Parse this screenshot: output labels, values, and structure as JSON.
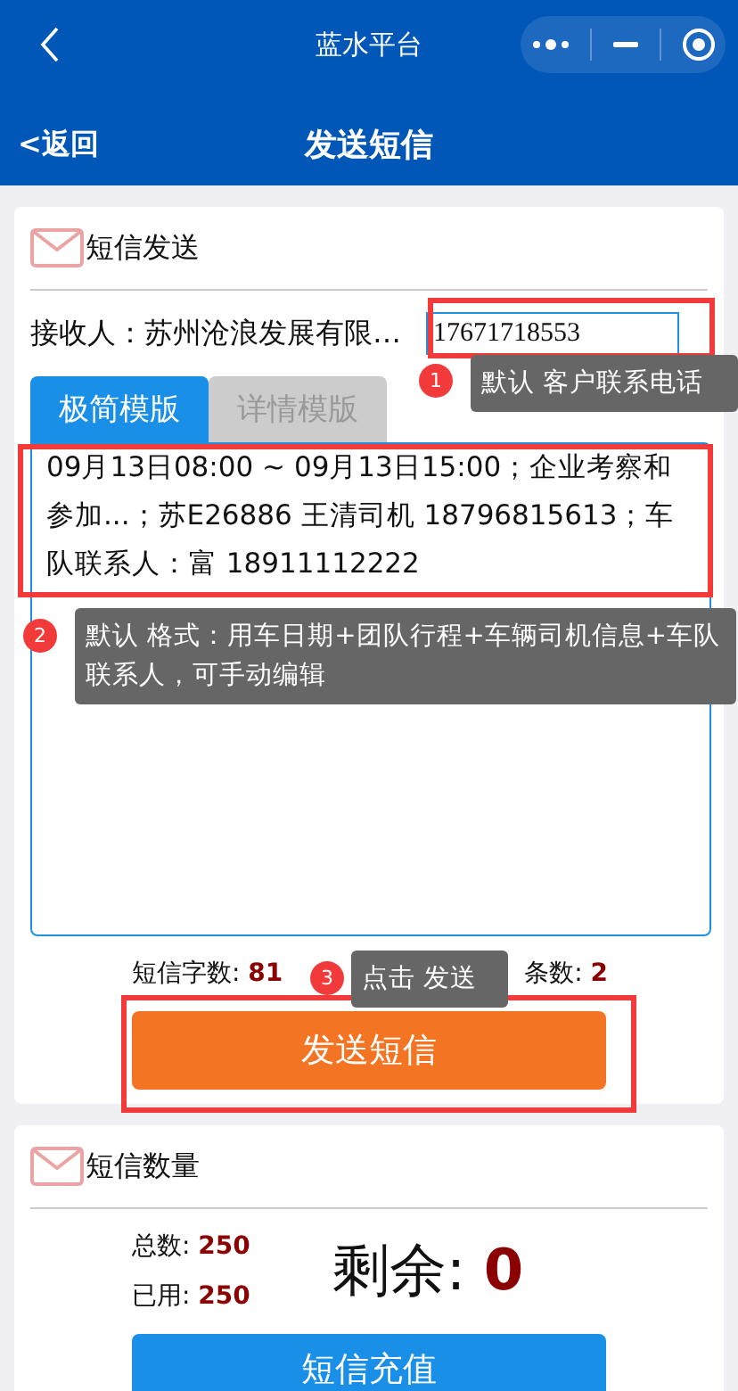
{
  "top_bar": {
    "title": "蓝水平台"
  },
  "nav": {
    "back": "<返回",
    "title": "发送短信"
  },
  "send_card": {
    "title": "短信发送",
    "recipient_label": "接收人：",
    "recipient_name": "苏州沧浪发展有限…",
    "phone": "17671718553",
    "tabs": [
      {
        "label": "极简模版",
        "selected": true
      },
      {
        "label": "详情模版",
        "selected": false
      }
    ],
    "message": "09月13日08:00 ~ 09月13日15:00；企业考察和参加...；苏E26886 王清司机 18796815613；车队联系人：富 18911112222",
    "char_count_label": "短信字数:",
    "char_count": "81",
    "sms_count_label": "条数:",
    "sms_count": "2",
    "send_button": "发送短信"
  },
  "quota_card": {
    "title": "短信数量",
    "total_label": "总数:",
    "total": "250",
    "used_label": "已用:",
    "used": "250",
    "remaining_label": "剩余:",
    "remaining": "0",
    "recharge_button": "短信充值"
  },
  "annotations": [
    {
      "number": "1",
      "text": "默认 客户联系电话"
    },
    {
      "number": "2",
      "text": "默认 格式：用车日期+团队行程+车辆司机信息+车队联系人，可手动编辑"
    },
    {
      "number": "3",
      "text": "点击  发送"
    }
  ]
}
